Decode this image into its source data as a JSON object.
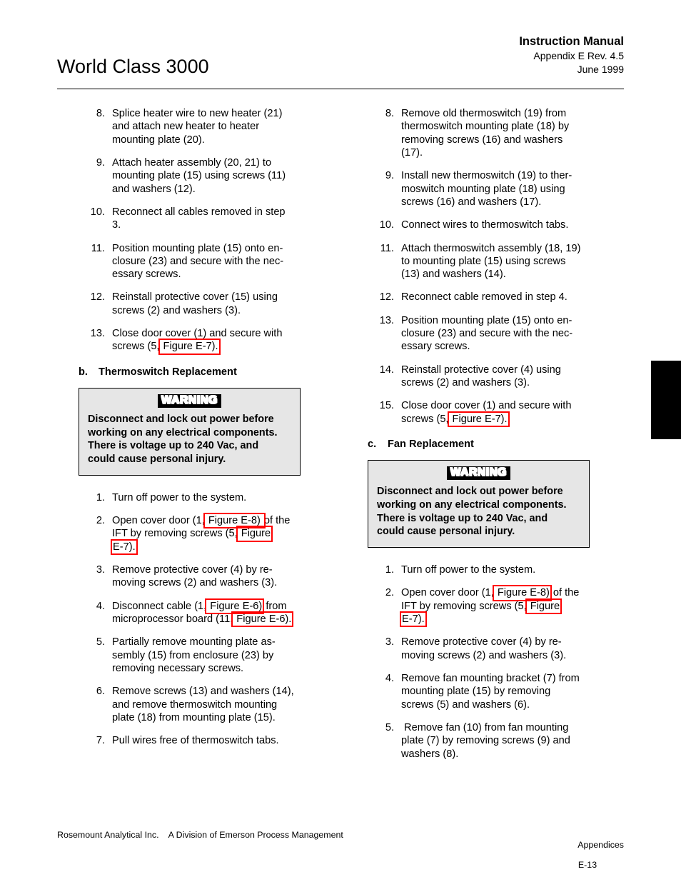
{
  "header": {
    "doc_title": "World Class 3000",
    "manual_label": "Instruction Manual",
    "appendix_rev": "Appendix E  Rev. 4.5",
    "date": "June 1999"
  },
  "warning": {
    "banner": "WARNING",
    "line1": "Disconnect and lock out power before",
    "line2": "working on any electrical components.",
    "line3": "There is voltage up to 240 Vac, and",
    "line4": "could cause personal injury."
  },
  "left_column": {
    "steps_top": [
      {
        "num": "8.",
        "lines": [
          "Splice heater wire to new heater (21)",
          "and attach new heater to heater",
          "mounting plate (20)."
        ]
      },
      {
        "num": "9.",
        "lines": [
          "Attach heater assembly (20, 21) to",
          "mounting plate (15) using screws (11)",
          "and washers (12)."
        ]
      },
      {
        "num": "10.",
        "lines": [
          "Reconnect all cables removed in step",
          "3."
        ]
      },
      {
        "num": "11.",
        "lines": [
          "Position mounting plate (15) onto en-",
          "closure (23) and secure with the nec-",
          "essary screws."
        ]
      },
      {
        "num": "12.",
        "lines": [
          "Reinstall protective cover (15) using",
          "screws (2) and washers (3)."
        ]
      }
    ],
    "step13": {
      "num": "13.",
      "line1": "Close door cover (1) and secure with",
      "line2_pre": "screws (5,",
      "line2_hl": " Figure E-7)."
    },
    "subhead": {
      "letter": "b.",
      "title": "Thermoswitch Replacement"
    },
    "steps_bottom": [
      {
        "num": "1.",
        "lines": [
          "Turn off power to the system."
        ]
      },
      {
        "num": "3.",
        "lines": [
          "Remove protective cover (4) by re-",
          "moving screws (2) and washers (3)."
        ]
      },
      {
        "num": "5.",
        "lines": [
          "Partially remove mounting plate as-",
          "sembly (15) from enclosure (23) by",
          "removing necessary screws."
        ]
      },
      {
        "num": "6.",
        "lines": [
          "Remove screws (13) and washers (14),",
          "and remove thermoswitch mounting",
          "plate (18) from mounting plate (15)."
        ]
      },
      {
        "num": "7.",
        "lines": [
          "Pull wires free of thermoswitch tabs."
        ]
      }
    ],
    "step2": {
      "num": "2.",
      "l1_pre": "Open cover door (1,",
      "l1_hl": " Figure E-8) ",
      "l1_post": "of the",
      "l2_pre": "IFT by removing screws (5,",
      "l2_hl": " Figure",
      "l3_hl": "E-7)."
    },
    "step4": {
      "num": "4.",
      "l1_pre": "Disconnect cable (1,",
      "l1_hl": " Figure E-6)",
      "l1_post": " from",
      "l2_pre": "microprocessor board (11,",
      "l2_hl": " Figure E-6)."
    }
  },
  "right_column": {
    "steps_top": [
      {
        "num": "8.",
        "lines": [
          "Remove old thermoswitch (19) from",
          "thermoswitch mounting plate (18) by",
          "removing screws (16) and washers",
          "(17)."
        ]
      },
      {
        "num": "9.",
        "lines": [
          "Install new thermoswitch (19) to ther-",
          "moswitch mounting plate (18) using",
          "screws (16) and washers (17)."
        ]
      },
      {
        "num": "10.",
        "lines": [
          "Connect wires to thermoswitch tabs."
        ]
      },
      {
        "num": "11.",
        "lines": [
          "Attach thermoswitch assembly (18, 19)",
          "to mounting plate (15) using screws",
          "(13) and washers (14)."
        ]
      },
      {
        "num": "12.",
        "lines": [
          "Reconnect cable removed in step 4."
        ]
      },
      {
        "num": "13.",
        "lines": [
          "Position mounting plate (15) onto en-",
          "closure (23) and secure with the nec-",
          "essary screws."
        ]
      },
      {
        "num": "14.",
        "lines": [
          "Reinstall protective cover (4) using",
          "screws (2) and washers (3)."
        ]
      }
    ],
    "step15": {
      "num": "15.",
      "line1": "Close door cover (1) and secure with",
      "line2_pre": "screws (5,",
      "line2_hl": " Figure E-7)."
    },
    "subhead": {
      "letter": "c.",
      "title": "Fan Replacement"
    },
    "steps_bottom": [
      {
        "num": "1.",
        "lines": [
          "Turn off power to the system."
        ]
      },
      {
        "num": "3.",
        "lines": [
          "Remove protective cover (4) by re-",
          "moving screws (2) and washers (3)."
        ]
      },
      {
        "num": "4.",
        "lines": [
          "Remove fan mounting bracket (7) from",
          "mounting plate (15) by removing",
          "screws (5) and washers (6)."
        ]
      },
      {
        "num": "5.",
        "lines": [
          " Remove fan (10) from fan mounting",
          "plate (7) by removing screws (9) and",
          "washers (8)."
        ]
      }
    ],
    "step2": {
      "num": "2.",
      "l1_pre": "Open cover door (1,",
      "l1_hl": " Figure E-8)",
      "l1_post": " of the",
      "l2_pre": "IFT by removing screws (5,",
      "l2_hl": " Figure",
      "l3_hl": "E-7)."
    }
  },
  "footer": {
    "left": "Rosemount Analytical Inc.    A Division of Emerson Process Management",
    "section": "Appendices",
    "page": "E-13"
  },
  "colors": {
    "annotation": "#ff0000",
    "warning_background": "#e6e6e6",
    "text": "#000000",
    "tab": "#000000"
  }
}
